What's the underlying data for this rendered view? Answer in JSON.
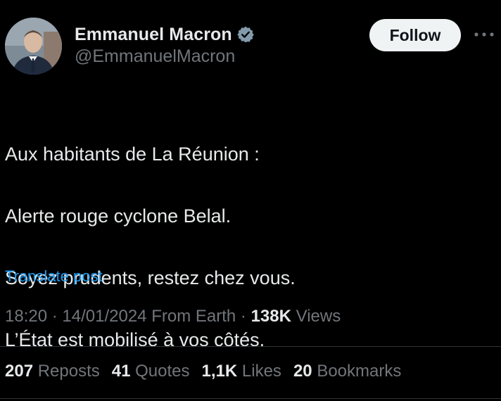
{
  "author": {
    "display_name": "Emmanuel Macron",
    "handle": "@EmmanuelMacron",
    "verified_color": "#829aab"
  },
  "actions": {
    "follow_label": "Follow",
    "more_icon": "more-horizontal-icon"
  },
  "post": {
    "lines": [
      "Aux habitants de La Réunion :",
      "Alerte rouge cyclone Belal.",
      "Soyez prudents, restez chez vous.",
      "L’État est mobilisé à vos côtés."
    ],
    "translate_label": "Translate post"
  },
  "meta": {
    "time": "18:20",
    "date": "14/01/2024",
    "source": "From Earth",
    "views_count": "138K",
    "views_label": "Views"
  },
  "stats": [
    {
      "count": "207",
      "label": "Reposts"
    },
    {
      "count": "41",
      "label": "Quotes"
    },
    {
      "count": "1,1K",
      "label": "Likes"
    },
    {
      "count": "20",
      "label": "Bookmarks"
    }
  ],
  "colors": {
    "background": "#000000",
    "primary_text": "#e7e9ea",
    "secondary_text": "#71767b",
    "link": "#1d9bf0",
    "follow_bg": "#eff3f4"
  }
}
